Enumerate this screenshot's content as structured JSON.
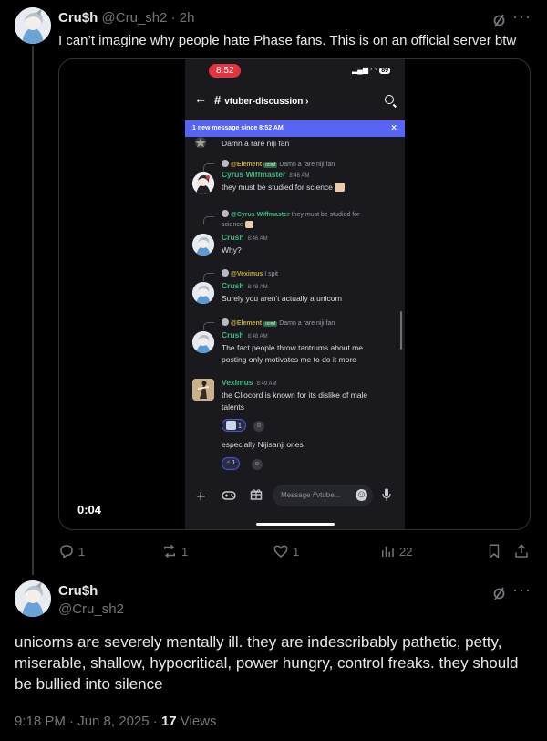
{
  "tweet1": {
    "author_name": "Cru$h",
    "author_handle": "@Cru_sh2",
    "separator": "·",
    "time_ago": "2h",
    "text": "I can’t imagine why people hate Phase fans. This is on an official server btw",
    "more_label": "···",
    "video_timestamp": "0:04",
    "actions": {
      "replies": "1",
      "reposts": "1",
      "likes": "1",
      "views": "22"
    }
  },
  "phone": {
    "status_time": "8:52",
    "battery": "89",
    "back_icon": "←",
    "channel_name": "vtuber-discussion",
    "channel_chevron": "›",
    "banner_text": "1 new message since 8:52 AM",
    "banner_close": "×",
    "messages": [
      {
        "body": "Damn a rare niji fan"
      },
      {
        "reply_mention": "@Element",
        "reply_tag": "oomf",
        "reply_text": "Damn a rare niji fan",
        "name": "Cyrus Wiffmaster",
        "time": "8:46 AM",
        "body": "they must be studied for science"
      },
      {
        "reply_mention": "@Cyrus Wiffmaster",
        "reply_text": "they must be studied for",
        "reply_text2": "science",
        "name": "Crush",
        "time": "8:46 AM",
        "body": "Why?"
      },
      {
        "reply_mention": "@Veximus",
        "reply_text": "I spit",
        "name": "Crush",
        "time": "8:48 AM",
        "body": "Surely you aren't actually a unicorn"
      },
      {
        "reply_mention": "@Element",
        "reply_tag": "oomf",
        "reply_text": "Damn a rare niji fan",
        "name": "Crush",
        "time": "8:48 AM",
        "body": "The fact people throw tantrums about me",
        "body2": "posting only motivates me to do it more"
      },
      {
        "name": "Veximus",
        "time": "8:49 AM",
        "body": "the Cliocord is known for its dislike of male",
        "body2": "talents",
        "reaction_count": "1",
        "followup": "especially Nijisanji ones",
        "followup_reaction_count": "1"
      }
    ],
    "input_placeholder": "Message #vtube..."
  },
  "tweet2": {
    "author_name": "Cru$h",
    "author_handle": "@Cru_sh2",
    "text": "unicorns are severely mentally ill. they are indescribably pathetic, petty, miserable, shallow, hypocritical, power hungry, control freaks. they should be bullied into silence",
    "time": "9:18 PM · Jun 8, 2025 ·",
    "views_count": "17",
    "views_label": "Views",
    "more_label": "···"
  },
  "colors": {
    "background": "#000000",
    "text_primary": "#e7e9ea",
    "text_muted": "#71767b",
    "discord_blurple": "#5865f2",
    "discord_name_green": "#3fb77f",
    "discord_mention_gold": "#c8a73e"
  },
  "icons": [
    "grok-icon",
    "more-icon",
    "reply-icon",
    "repost-icon",
    "like-icon",
    "views-icon",
    "bookmark-icon",
    "share-icon"
  ]
}
